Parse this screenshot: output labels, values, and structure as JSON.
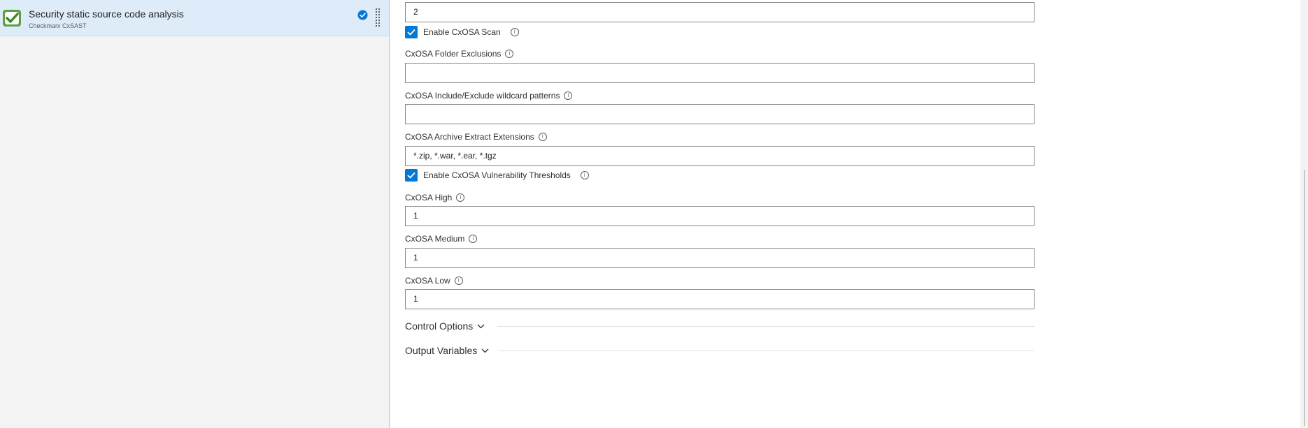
{
  "task": {
    "title": "Security static source code analysis",
    "subtitle": "Checkmarx CxSAST"
  },
  "form": {
    "top_value": "2",
    "enable_cxosa_scan": {
      "label": "Enable CxOSA Scan",
      "checked": true
    },
    "folder_exclusions": {
      "label": "CxOSA Folder Exclusions",
      "value": ""
    },
    "wildcard_patterns": {
      "label": "CxOSA Include/Exclude wildcard patterns",
      "value": ""
    },
    "archive_extensions": {
      "label": "CxOSA Archive Extract Extensions",
      "value": "*.zip, *.war, *.ear, *.tgz"
    },
    "enable_thresholds": {
      "label": "Enable CxOSA Vulnerability Thresholds",
      "checked": true
    },
    "high": {
      "label": "CxOSA High",
      "value": "1"
    },
    "medium": {
      "label": "CxOSA Medium",
      "value": "1"
    },
    "low": {
      "label": "CxOSA Low",
      "value": "1"
    }
  },
  "sections": {
    "control_options": "Control Options",
    "output_variables": "Output Variables"
  },
  "icons": {
    "task": "checkmarx-task-icon",
    "check": "check-circle-icon",
    "drag": "drag-handle-icon",
    "info": "info-icon",
    "chevron": "chevron-down-icon"
  },
  "colors": {
    "accent": "#0078d4",
    "selected_bg": "#deecf9",
    "icon_green": "#6ab04c"
  }
}
